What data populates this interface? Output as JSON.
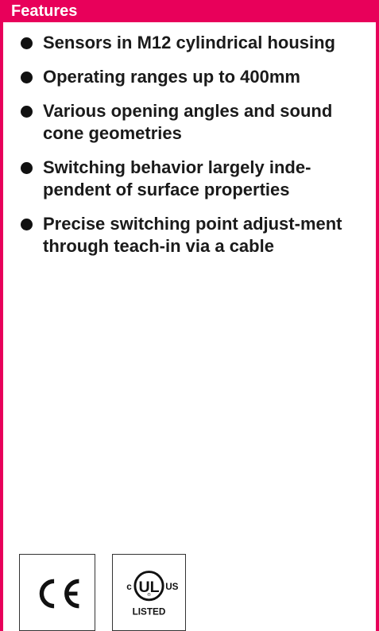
{
  "header": {
    "title": "Features"
  },
  "features": [
    "Sensors in M12 cylindrical housing",
    "Operating ranges up to 400mm",
    "Various opening angles and sound cone geometries",
    "Switching behavior largely inde-pendent of surface properties",
    "Precise switching point adjust-ment through teach-in via a cable"
  ],
  "certifications": {
    "ce_mark": "CE",
    "ul": {
      "mark": "UL",
      "left": "c",
      "right": "US",
      "listed": "LISTED"
    }
  },
  "colors": {
    "accent": "#e8005a",
    "text": "#1a1a1a"
  }
}
